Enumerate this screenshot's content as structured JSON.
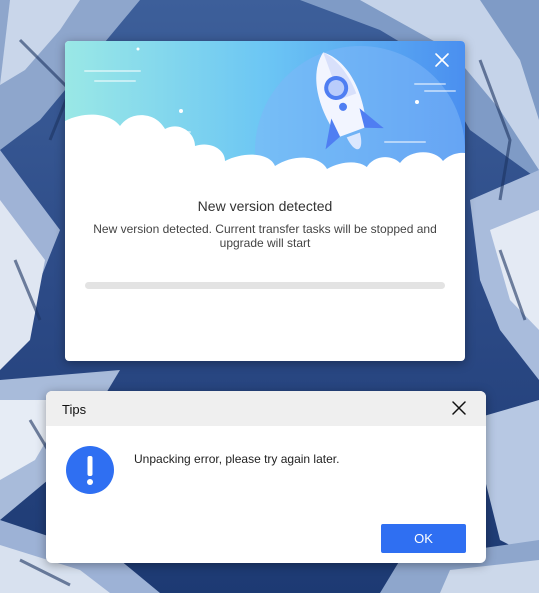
{
  "update_dialog": {
    "title": "New version detected",
    "message": "New version detected. Current transfer tasks will be stopped and upgrade will start",
    "progress": 0
  },
  "tips_dialog": {
    "title": "Tips",
    "message": "Unpacking error, please try again later.",
    "ok_label": "OK",
    "icon": "exclamation-icon",
    "accent_color": "#2f6ff2"
  }
}
